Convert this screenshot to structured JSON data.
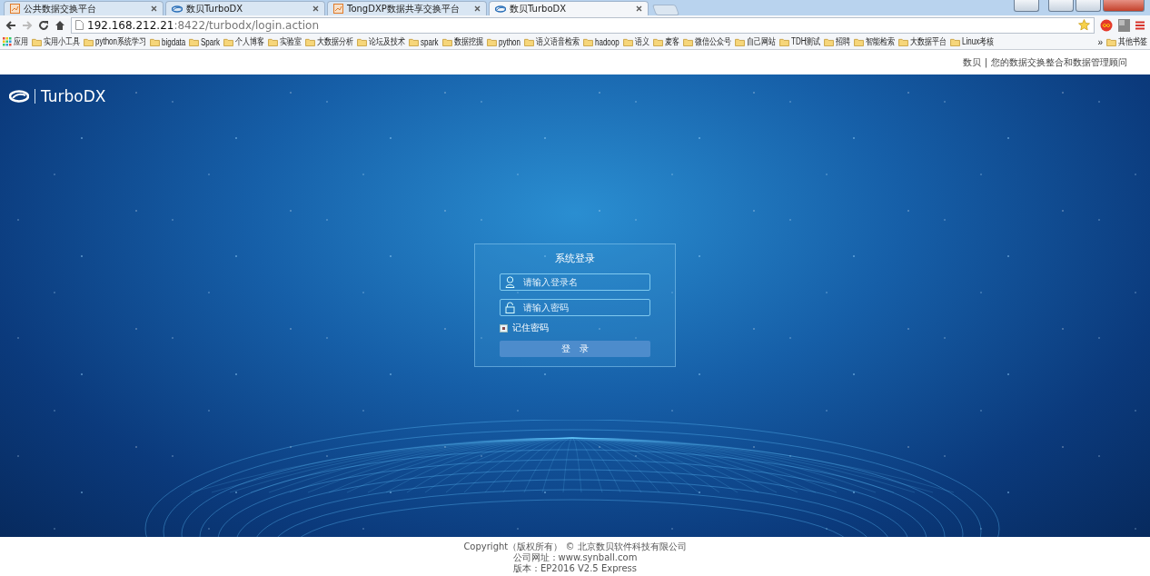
{
  "browser": {
    "tabs": [
      {
        "title": "公共数据交换平台",
        "selected": false,
        "kind": "chart"
      },
      {
        "title": "数贝TurboDX",
        "selected": false,
        "kind": "logo"
      },
      {
        "title": "TongDXP数据共享交换平台",
        "selected": false,
        "kind": "chart"
      },
      {
        "title": "数贝TurboDX",
        "selected": true,
        "kind": "logo"
      }
    ],
    "address": {
      "host": "192.168.212.21",
      "rest": ":8422/turbodx/login.action"
    },
    "bookmarks": [
      {
        "label": "应用",
        "kind": "apps"
      },
      {
        "label": "实用小工具",
        "kind": "folder"
      },
      {
        "label": "python系统学习",
        "kind": "folder"
      },
      {
        "label": "bigdata",
        "kind": "folder"
      },
      {
        "label": "Spark",
        "kind": "folder"
      },
      {
        "label": "个人博客",
        "kind": "folder"
      },
      {
        "label": "实验室",
        "kind": "folder"
      },
      {
        "label": "大数据分析",
        "kind": "folder"
      },
      {
        "label": "论坛及技术",
        "kind": "folder"
      },
      {
        "label": "spark",
        "kind": "folder"
      },
      {
        "label": "数据挖掘",
        "kind": "folder"
      },
      {
        "label": "python",
        "kind": "folder"
      },
      {
        "label": "语义语音检索",
        "kind": "folder"
      },
      {
        "label": "hadoop",
        "kind": "folder"
      },
      {
        "label": "语义",
        "kind": "folder"
      },
      {
        "label": "麦客",
        "kind": "folder"
      },
      {
        "label": "微信公众号",
        "kind": "folder"
      },
      {
        "label": "自己网站",
        "kind": "folder"
      },
      {
        "label": "TDH测试",
        "kind": "folder"
      },
      {
        "label": "招聘",
        "kind": "folder"
      },
      {
        "label": "智能检索",
        "kind": "folder"
      },
      {
        "label": "大数据平台",
        "kind": "folder"
      },
      {
        "label": "Linux考核",
        "kind": "folder"
      }
    ],
    "more": "»",
    "other_bookmarks": "其他书签"
  },
  "header": {
    "brand": "数贝",
    "separator": "|",
    "slogan": "您的数据交换整合和数据管理顾问"
  },
  "logo": {
    "text": "TurboDX"
  },
  "login": {
    "title": "系统登录",
    "username": {
      "placeholder": "请输入登录名"
    },
    "password": {
      "placeholder": "请输入密码"
    },
    "remember": {
      "label": "记住密码",
      "checked": true
    },
    "submit": "登　录"
  },
  "footer": {
    "lines": [
      "Copyright（版权所有） © 北京数贝软件科技有限公司",
      "公司网址：www.synball.com",
      "版本：EP2016 V2.5 Express"
    ]
  }
}
